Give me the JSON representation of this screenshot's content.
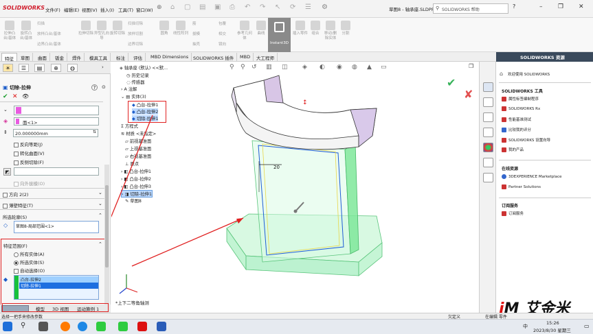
{
  "app": {
    "logo": "SOLIDWORKS",
    "menus": [
      "文件(F)",
      "编辑(E)",
      "视图(V)",
      "插入(I)",
      "工具(T)",
      "窗口(W)"
    ],
    "doc_title": "草图8 - 轴承座.SLDPRT *",
    "search_placeholder": "SOLIDWORKS 帮助",
    "win_min": "–",
    "win_restore": "❐",
    "win_close": "✕"
  },
  "ribbon": {
    "buttons": [
      "拉伸凸台/基体",
      "旋转凸台/基体",
      "扫描",
      "放样凸台/基体",
      "边界凸台/基体",
      "拉伸切除",
      "异型孔向导",
      "旋转切除",
      "放样切割",
      "边界切除",
      "圆角",
      "线性阵列",
      "筋",
      "拔模",
      "抽壳",
      "包覆",
      "相交",
      "镜向",
      "参考几何体",
      "曲线",
      "Instant3D",
      "插入零件",
      "组合",
      "移动/删除实体",
      "分割"
    ],
    "row_labels": [
      "扫描",
      "放样凸台/基体",
      "边界凸台/基体",
      "扫描切除",
      "放样切割",
      "边界切除"
    ],
    "instant3d": "Instant3D"
  },
  "tabs": [
    "特征",
    "草图",
    "曲面",
    "钣金",
    "焊件",
    "模具工具",
    "标注",
    "评估",
    "MBD Dimensions",
    "SOLIDWORKS 插件",
    "MBD",
    "大工程师"
  ],
  "active_tab": "特征",
  "left_panel": {
    "title": "切除-拉伸",
    "help": "?",
    "ok": "✔",
    "cancel": "✕",
    "eye": "👁",
    "face_label": "面<1>",
    "depth_value": "20.000000mm",
    "checkboxes": [
      "反向等距(J)",
      "转化曲面(V)",
      "反侧切除(F)"
    ],
    "draft_outward": "向外拔模(O)",
    "dir2": "方向 2(2)",
    "thin": "薄壁特征(T)",
    "contours_title": "所选轮廓(S)",
    "contour_value": "草图8-局部范围<1>",
    "scope_title": "特征范围(F)",
    "scope_radios": [
      "所有实体(A)",
      "所选实体(S)"
    ],
    "auto_select": "自动选择(O)",
    "bodies": [
      "凸台-拉伸2",
      "切除-拉伸1"
    ]
  },
  "bottom_tabs": [
    "模型",
    "3D 视图",
    "运动算例 1"
  ],
  "status_text": "选择一把手来修改参数",
  "status_right": [
    "欠定义",
    "在编辑 零件"
  ],
  "tree": {
    "root": "轴承座 (默认) <<默...",
    "items": [
      "历史记录",
      "传感器",
      "注解",
      "实体(3)",
      "凸台-拉伸1",
      "凸台-拉伸2",
      "切除-拉伸1",
      "方程式",
      "材质 <未指定>",
      "前视基准面",
      "上视基准面",
      "右视基准面",
      "原点",
      "凸台-拉伸1",
      "凸台-拉伸2",
      "凸台-拉伸3",
      "切除-拉伸1",
      "草图8"
    ]
  },
  "graphics": {
    "dim_label": "20",
    "view_label": "*上下二等角轴测"
  },
  "task_pane": {
    "title": "SOLIDWORKS 资源",
    "welcome": "欢迎使用 SOLIDWORKS",
    "tools_title": "SOLIDWORKS 工具",
    "tools": [
      "属性标签编制程序",
      "SOLIDWORKS Rx",
      "性能基准测试",
      "比较我的评分",
      "SOLIDWORKS 设置向导",
      "我的产品"
    ],
    "online_title": "在线资源",
    "online": [
      "3DEXPERIENCE Marketplace",
      "Partner Solutions"
    ],
    "sub_title": "订阅服务",
    "sub": [
      "订阅服务"
    ]
  },
  "watermark": "艾金米",
  "taskbar": {
    "time": "15:26",
    "date": "2023/8/30 星期三",
    "ime": "中"
  },
  "colors": {
    "red": "#e02020",
    "green_body": "#7fe89a",
    "select_blue": "#1e88ff"
  }
}
